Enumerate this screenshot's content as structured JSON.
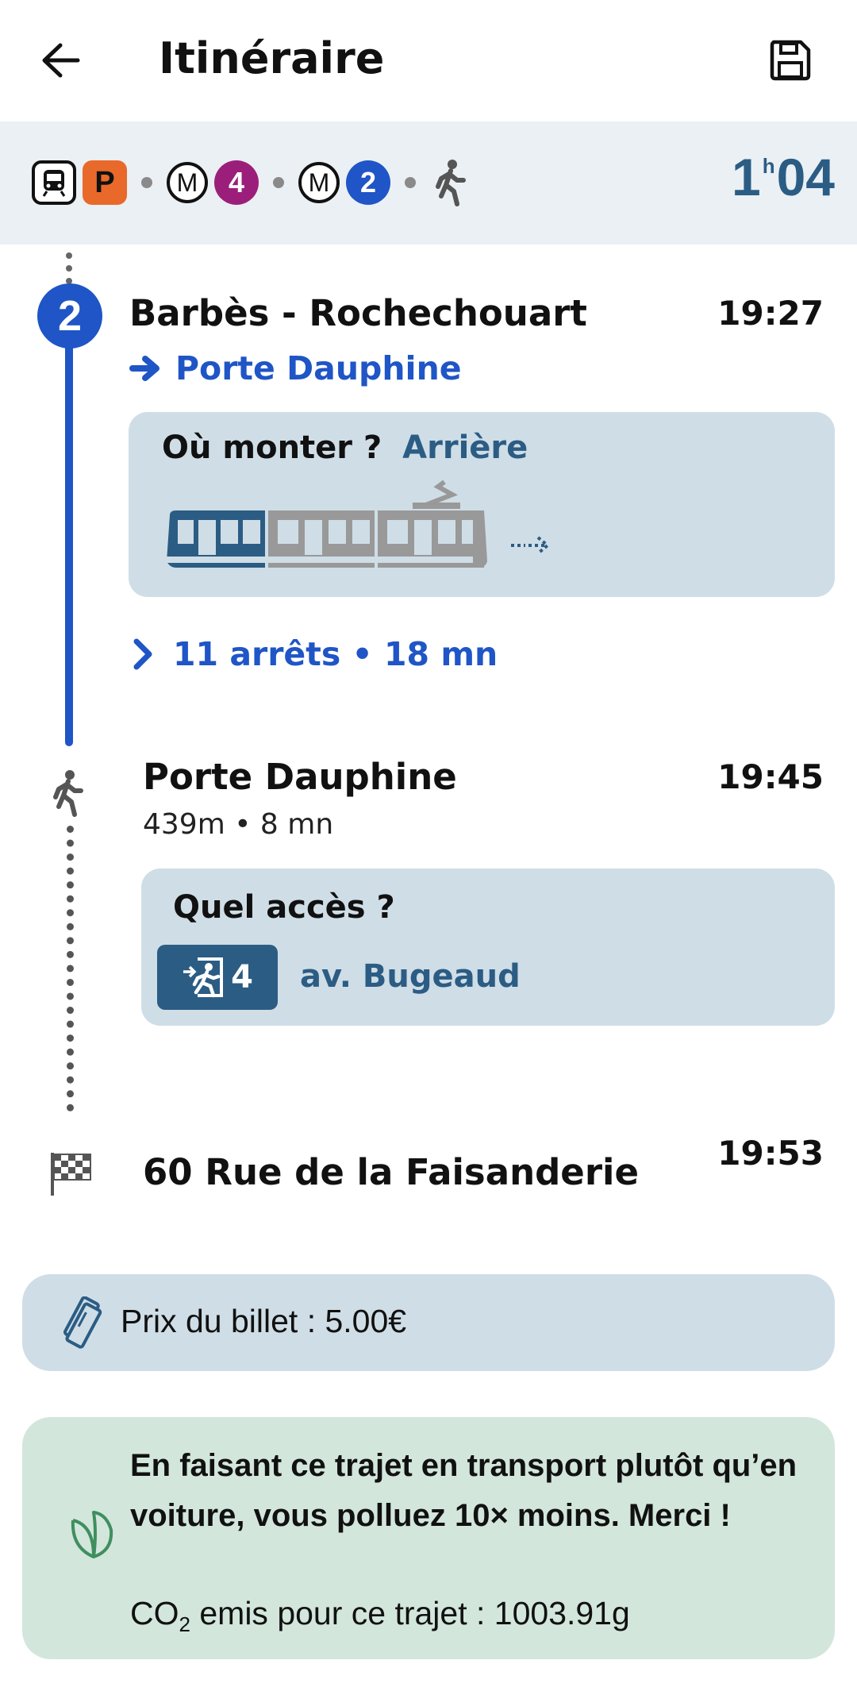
{
  "header": {
    "title": "Itinéraire"
  },
  "summary": {
    "train_icon": "train-icon",
    "rer_label": "P",
    "metro_letter_1": "M",
    "line_1": "4",
    "line_1_color": "#9b1f7a",
    "metro_letter_2": "M",
    "line_2": "2",
    "line_2_color": "#1f55c6",
    "walk_icon": "walk-icon",
    "duration_hours": "1",
    "duration_sep": "h",
    "duration_minutes": "04"
  },
  "segment_metro": {
    "line": "2",
    "line_color": "#1f55c6",
    "station": "Barbès - Rochechouart",
    "time": "19:27",
    "direction": "Porte Dauphine",
    "boarding_label": "Où monter ?",
    "boarding_value": "Arrière",
    "stops_summary": "11 arrêts • 18 mn"
  },
  "segment_walk": {
    "station": "Porte Dauphine",
    "time": "19:45",
    "details": "439m • 8 mn",
    "access_label": "Quel accès ?",
    "exit_number": "4",
    "exit_street": "av. Bugeaud"
  },
  "destination": {
    "address": "60 Rue de la Faisanderie",
    "time": "19:53"
  },
  "price": {
    "text": "Prix du billet : 5.00€"
  },
  "eco": {
    "message": "En faisant ce trajet en transport plutôt qu’en voiture, vous polluez 10× moins. Merci !",
    "co2_prefix": "CO",
    "co2_sub": "2",
    "co2_rest": " emis pour ce trajet : 1003.91g"
  }
}
